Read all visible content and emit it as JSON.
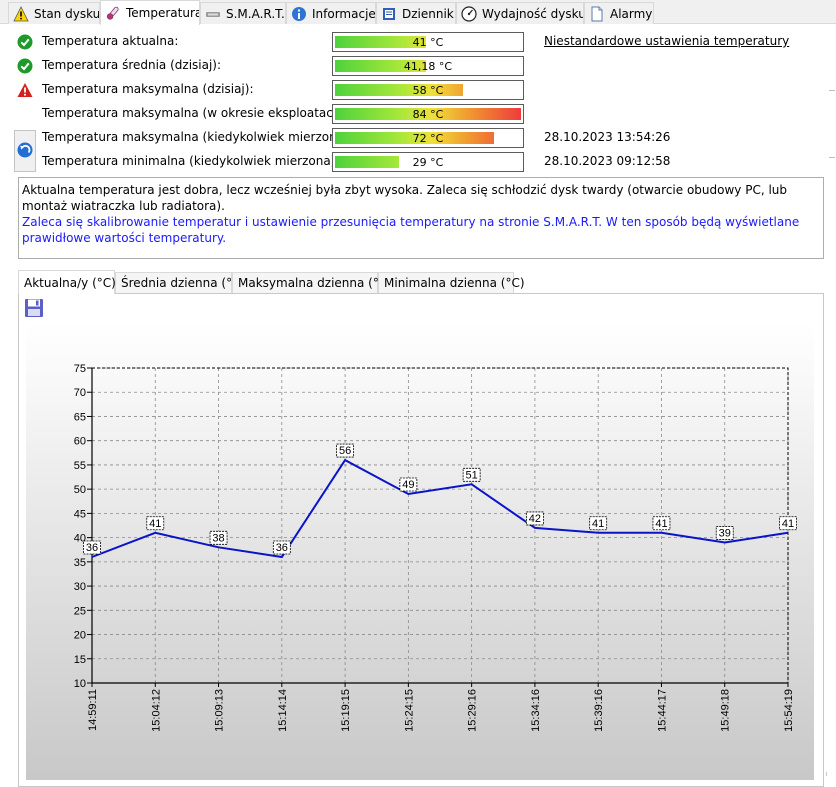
{
  "tabs": [
    {
      "label": "Stan dysku",
      "icon": "warning-icon",
      "active": false
    },
    {
      "label": "Temperatura",
      "icon": "thermometer-icon",
      "active": true
    },
    {
      "label": "S.M.A.R.T.",
      "icon": "smart-icon",
      "active": false
    },
    {
      "label": "Informacje",
      "icon": "info-icon",
      "active": false
    },
    {
      "label": "Dziennik",
      "icon": "journal-icon",
      "active": false
    },
    {
      "label": "Wydajność dysku",
      "icon": "gauge-icon",
      "active": false
    },
    {
      "label": "Alarmy",
      "icon": "document-icon",
      "active": false
    }
  ],
  "temps": {
    "current": {
      "label": "Temperatura aktualna:",
      "value": "41 °C",
      "level": 41,
      "status": "ok"
    },
    "average": {
      "label": "Temperatura średnia (dzisiaj):",
      "value": "41,18 °C",
      "level": 41.18,
      "status": "ok"
    },
    "max_today": {
      "label": "Temperatura maksymalna (dzisiaj):",
      "value": "58 °C",
      "level": 58,
      "status": "warning"
    },
    "max_lifetime": {
      "label": "Temperatura maksymalna (w okresie eksploatacji):",
      "value": "84 °C",
      "level": 84
    },
    "max_ever": {
      "label": "Temperatura maksymalna (kiedykolwiek mierzona):",
      "value": "72 °C",
      "level": 72,
      "date": "28.10.2023 13:54:26"
    },
    "min_ever": {
      "label": "Temperatura minimalna (kiedykolwiek mierzona):",
      "value": "29 °C",
      "level": 29,
      "date": "28.10.2023 09:12:58"
    }
  },
  "custom_settings_link": "Niestandardowe ustawienia temperatury",
  "message": {
    "line1": "Aktualna temperatura jest dobra, lecz wcześniej była zbyt wysoka. Zaleca się schłodzić dysk twardy (otwarcie obudowy PC, lub montaż wiatraczka lub radiatora).",
    "line2": "Zaleca się skalibrowanie temperatur i ustawienie przesunięcia temperatury na stronie S.M.A.R.T. W ten sposób będą wyświetlane prawidłowe wartości temperatury."
  },
  "chart_tabs": [
    "Aktualna/y (°C)",
    "Średnia dzienna (°C)",
    "Maksymalna dzienna (°C)",
    "Minimalna dzienna (°C)"
  ],
  "colors": {
    "line": "#0a14c8",
    "ok": "#1e9a2a",
    "warning": "#d62020",
    "accent_blue": "#1a1aff"
  },
  "chart_data": {
    "type": "line",
    "x": [
      "14:59:11",
      "15:04:12",
      "15:09:13",
      "15:14:14",
      "15:19:15",
      "15:24:15",
      "15:29:16",
      "15:34:16",
      "15:39:16",
      "15:44:17",
      "15:49:18",
      "15:54:19"
    ],
    "series": [
      {
        "values": [
          36,
          41,
          38,
          36,
          56,
          49,
          51,
          42,
          41,
          41,
          39,
          41
        ]
      }
    ],
    "yticks": [
      10,
      15,
      20,
      25,
      30,
      35,
      40,
      45,
      50,
      55,
      60,
      65,
      70,
      75
    ],
    "ylim": [
      10,
      75
    ],
    "grid": true,
    "data_labels": true,
    "title": "",
    "xlabel": "",
    "ylabel": ""
  }
}
